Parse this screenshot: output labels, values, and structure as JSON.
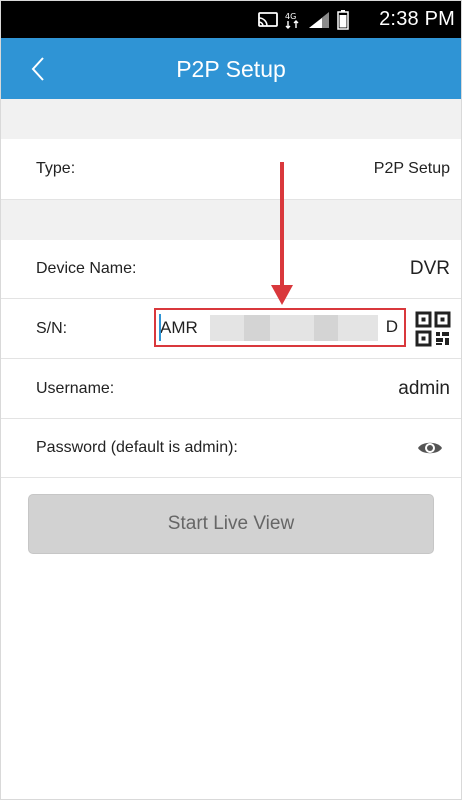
{
  "status_bar": {
    "time": "2:38 PM",
    "icons": [
      "cast-icon",
      "network-type-icon",
      "signal-icon",
      "battery-icon"
    ]
  },
  "app_bar": {
    "title": "P2P Setup",
    "back_icon": "chevron-left-icon"
  },
  "form": {
    "type": {
      "label": "Type:",
      "value": "P2P Setup"
    },
    "device_name": {
      "label": "Device Name:",
      "value": "DVR"
    },
    "sn": {
      "label": "S/N:",
      "value_start": "AMR",
      "value_end": "D",
      "qr_icon": "qr-code-icon"
    },
    "username": {
      "label": "Username:",
      "value": "admin"
    },
    "password": {
      "label": "Password (default is admin):",
      "icon": "eye-icon"
    }
  },
  "start_button": {
    "label": "Start Live View"
  },
  "colors": {
    "app_bar": "#2f94d5",
    "status_bar": "#000000",
    "highlight": "#d9383c",
    "button": "#d2d2d2"
  }
}
